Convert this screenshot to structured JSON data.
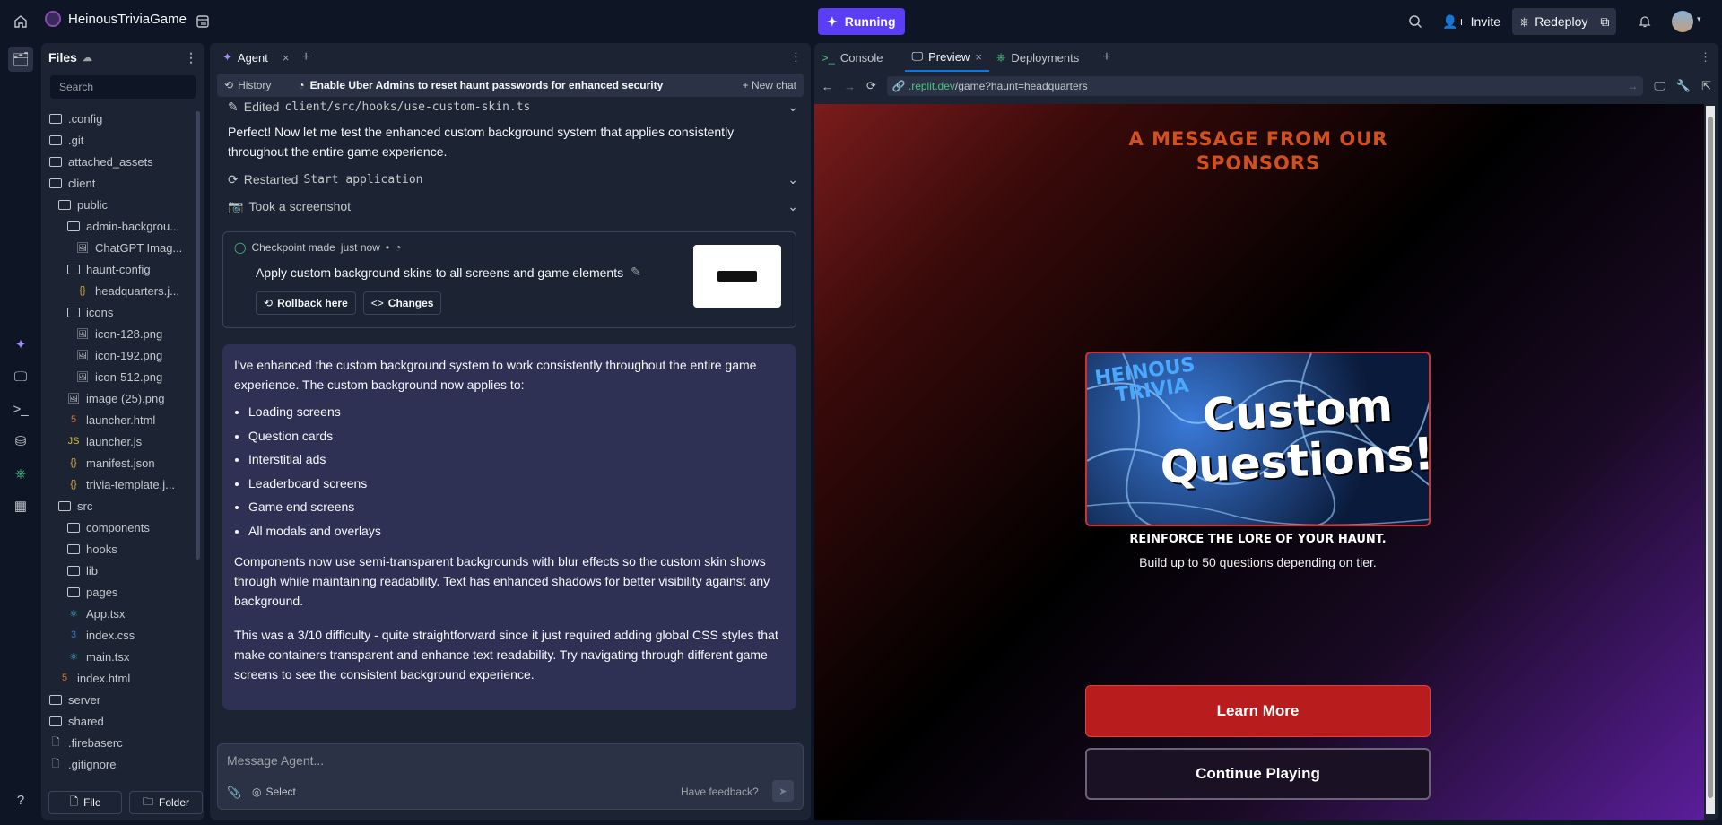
{
  "app": {
    "project": "HeinousTriviaGame",
    "run_label": "Running",
    "invite": "Invite",
    "redeploy": "Redeploy"
  },
  "files": {
    "title": "Files",
    "search_placeholder": "Search",
    "file_btn": "File",
    "folder_btn": "Folder",
    "items": [
      {
        "name": ".config",
        "type": "folder",
        "depth": 0
      },
      {
        "name": ".git",
        "type": "folder",
        "depth": 0
      },
      {
        "name": "attached_assets",
        "type": "folder",
        "depth": 0
      },
      {
        "name": "client",
        "type": "folder",
        "depth": 0
      },
      {
        "name": "public",
        "type": "folder",
        "depth": 1
      },
      {
        "name": "admin-backgrou...",
        "type": "folder",
        "depth": 2
      },
      {
        "name": "ChatGPT Imag...",
        "type": "image",
        "depth": 3
      },
      {
        "name": "haunt-config",
        "type": "folder",
        "depth": 2
      },
      {
        "name": "headquarters.j...",
        "type": "json",
        "depth": 3
      },
      {
        "name": "icons",
        "type": "folder",
        "depth": 2
      },
      {
        "name": "icon-128.png",
        "type": "image",
        "depth": 3
      },
      {
        "name": "icon-192.png",
        "type": "image",
        "depth": 3
      },
      {
        "name": "icon-512.png",
        "type": "image",
        "depth": 3
      },
      {
        "name": "image (25).png",
        "type": "image",
        "depth": 2
      },
      {
        "name": "launcher.html",
        "type": "html",
        "depth": 2
      },
      {
        "name": "launcher.js",
        "type": "js",
        "depth": 2
      },
      {
        "name": "manifest.json",
        "type": "json",
        "depth": 2
      },
      {
        "name": "trivia-template.j...",
        "type": "json",
        "depth": 2
      },
      {
        "name": "src",
        "type": "folder",
        "depth": 1
      },
      {
        "name": "components",
        "type": "folder",
        "depth": 2
      },
      {
        "name": "hooks",
        "type": "folder",
        "depth": 2
      },
      {
        "name": "lib",
        "type": "folder",
        "depth": 2
      },
      {
        "name": "pages",
        "type": "folder",
        "depth": 2
      },
      {
        "name": "App.tsx",
        "type": "react",
        "depth": 2
      },
      {
        "name": "index.css",
        "type": "css",
        "depth": 2
      },
      {
        "name": "main.tsx",
        "type": "react",
        "depth": 2
      },
      {
        "name": "index.html",
        "type": "html",
        "depth": 1
      },
      {
        "name": "server",
        "type": "folder",
        "depth": 0
      },
      {
        "name": "shared",
        "type": "folder",
        "depth": 0
      },
      {
        "name": ".firebaserc",
        "type": "file",
        "depth": 0
      },
      {
        "name": ".gitignore",
        "type": "file",
        "depth": 0
      }
    ]
  },
  "agent": {
    "tab": "Agent",
    "history": "History",
    "thread_title": "Enable Uber Admins to reset haunt passwords for enhanced security",
    "new_chat": "New chat",
    "edited_prefix": "Edited",
    "edited_file": "client/src/hooks/use-custom-skin.ts",
    "intro": "Perfect! Now let me test the enhanced custom background system that applies consistently throughout the entire game experience.",
    "restarted_prefix": "Restarted",
    "restarted_target": "Start application",
    "screenshot": "Took a screenshot",
    "checkpoint_made": "Checkpoint made",
    "checkpoint_time": "just now",
    "checkpoint_sep": "•",
    "checkpoint_title": "Apply custom background skins to all screens and game elements",
    "rollback": "Rollback here",
    "changes": "Changes",
    "msg_p1": "I've enhanced the custom background system to work consistently throughout the entire game experience. The custom background now applies to:",
    "bullets": [
      "Loading screens",
      "Question cards",
      "Interstitial ads",
      "Leaderboard screens",
      "Game end screens",
      "All modals and overlays"
    ],
    "msg_p2": "Components now use semi-transparent backgrounds with blur effects so the custom skin shows through while maintaining readability. Text has enhanced shadows for better visibility against any background.",
    "msg_p3": "This was a 3/10 difficulty - quite straightforward since it just required adding global CSS styles that make containers transparent and enhance text readability. Try navigating through different game screens to see the consistent background experience.",
    "composer_placeholder": "Message Agent...",
    "select": "Select",
    "feedback": "Have feedback?"
  },
  "preview": {
    "tabs": [
      "Console",
      "Preview",
      "Deployments"
    ],
    "url_host": ".replit.dev",
    "url_path": "/game?haunt=headquarters",
    "ad_title": "A MESSAGE FROM OUR SPONSORS",
    "img_brand_1": "HEINOUS",
    "img_brand_2": "TRIVIA",
    "img_text_1": "Custom",
    "img_text_2": "Questions!",
    "tagline": "REINFORCE THE LORE OF YOUR HAUNT.",
    "subline": "Build up to 50 questions depending on tier.",
    "learn_more": "Learn More",
    "continue": "Continue Playing"
  },
  "colors": {
    "accent": "#0079f2",
    "run": "#5b3df5",
    "cta": "#b91c1c"
  }
}
